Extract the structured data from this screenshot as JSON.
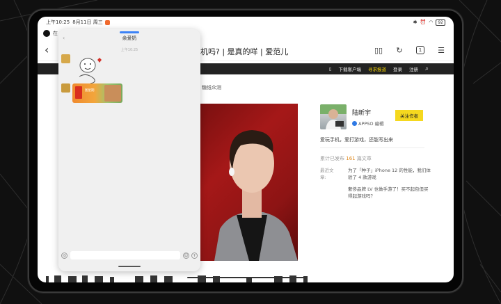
{
  "statusbar": {
    "time": "上午10:25",
    "date": "8月11日 周三",
    "battery": "92"
  },
  "tab": {
    "label": "在"
  },
  "addressbar": {
    "title": "机吗? | 是真的咩 | 爱范儿",
    "tab_count": "1"
  },
  "topnav": {
    "items": [
      {
        "label": "下载客户端"
      },
      {
        "label": "寻求报道"
      },
      {
        "label": "登录"
      },
      {
        "label": "注册"
      }
    ]
  },
  "subnav": {
    "label": "糖纸众测"
  },
  "author": {
    "name": "陆昕宇",
    "role": "APPSO 编辑",
    "follow_label": "关注作者",
    "bio": "爱玩手机，爱打游戏，还能写出来",
    "published_prefix": "累计已发布",
    "published_count": "161",
    "published_suffix": "篇文章",
    "recent_label_1": "最近文",
    "recent_label_2": "章:",
    "recent": [
      {
        "title": "为了「种子」iPhone 12 的性能，我们体验了 4 款游戏"
      },
      {
        "title": "奢侈品牌 LV 也做手游了！买不起包但买得起游戏吗？"
      }
    ]
  },
  "float_window": {
    "title": "余爱奶",
    "time": "上午10:25",
    "card_label": "图星期"
  }
}
